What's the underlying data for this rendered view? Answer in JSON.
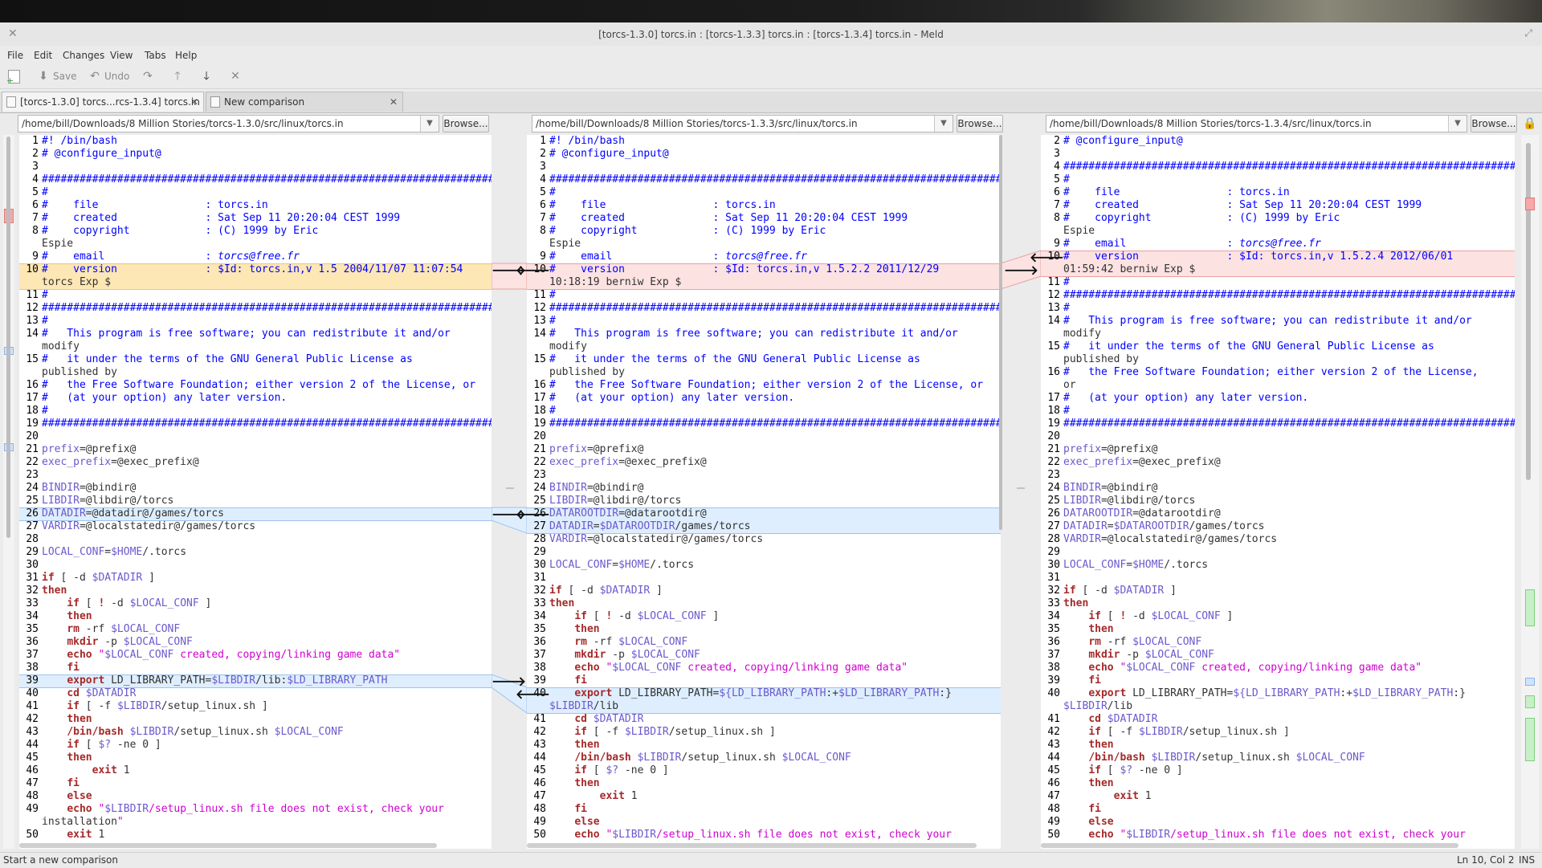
{
  "window": {
    "title": "[torcs-1.3.0] torcs.in : [torcs-1.3.3] torcs.in : [torcs-1.3.4] torcs.in - Meld"
  },
  "menu": [
    "File",
    "Edit",
    "Changes",
    "View",
    "Tabs",
    "Help"
  ],
  "toolbar": {
    "save_label": "Save",
    "undo_label": "Undo"
  },
  "tabs": [
    {
      "label": "[torcs-1.3.0] torcs...rcs-1.3.4] torcs.in",
      "active": true
    },
    {
      "label": "New comparison",
      "active": false
    }
  ],
  "paths": [
    "/home/bill/Downloads/8 Million Stories/torcs-1.3.0/src/linux/torcs.in",
    "/home/bill/Downloads/8 Million Stories/torcs-1.3.3/src/linux/torcs.in",
    "/home/bill/Downloads/8 Million Stories/torcs-1.3.4/src/linux/torcs.in"
  ],
  "browse_label": "Browse...",
  "left_lines": [
    {
      "n": "1",
      "t": "#! /bin/bash"
    },
    {
      "n": "2",
      "t": "# @configure_input@"
    },
    {
      "n": "3",
      "t": ""
    },
    {
      "n": "4",
      "t": "##########################################################################"
    },
    {
      "n": "5",
      "t": "#"
    },
    {
      "n": "6",
      "t": "#    file                 : torcs.in"
    },
    {
      "n": "7",
      "t": "#    created              : Sat Sep 11 20:20:04 CEST 1999"
    },
    {
      "n": "8",
      "t": "#    copyright            : (C) 1999 by Eric"
    },
    {
      "n": "",
      "t": "Espie"
    },
    {
      "n": "9",
      "t": "#    email                : torcs@free.fr"
    },
    {
      "n": "10",
      "t": "#    version              : $Id: torcs.in,v 1.5 2004/11/07 11:07:54"
    },
    {
      "n": "",
      "t": "torcs Exp $"
    },
    {
      "n": "11",
      "t": "#"
    },
    {
      "n": "12",
      "t": "##########################################################################"
    },
    {
      "n": "13",
      "t": "#"
    },
    {
      "n": "14",
      "t": "#   This program is free software; you can redistribute it and/or"
    },
    {
      "n": "",
      "t": "modify"
    },
    {
      "n": "15",
      "t": "#   it under the terms of the GNU General Public License as"
    },
    {
      "n": "",
      "t": "published by"
    },
    {
      "n": "16",
      "t": "#   the Free Software Foundation; either version 2 of the License, or"
    },
    {
      "n": "17",
      "t": "#   (at your option) any later version."
    },
    {
      "n": "18",
      "t": "#"
    },
    {
      "n": "19",
      "t": "##########################################################################"
    },
    {
      "n": "20",
      "t": ""
    },
    {
      "n": "21",
      "t": "prefix=@prefix@"
    },
    {
      "n": "22",
      "t": "exec_prefix=@exec_prefix@"
    },
    {
      "n": "23",
      "t": ""
    },
    {
      "n": "24",
      "t": "BINDIR=@bindir@"
    },
    {
      "n": "25",
      "t": "LIBDIR=@libdir@/torcs"
    },
    {
      "n": "26",
      "t": "DATADIR=@datadir@/games/torcs"
    },
    {
      "n": "27",
      "t": "VARDIR=@localstatedir@/games/torcs"
    },
    {
      "n": "28",
      "t": ""
    },
    {
      "n": "29",
      "t": "LOCAL_CONF=$HOME/.torcs"
    },
    {
      "n": "30",
      "t": ""
    },
    {
      "n": "31",
      "t": "if [ -d $DATADIR ]"
    },
    {
      "n": "32",
      "t": "then"
    },
    {
      "n": "33",
      "t": "    if [ ! -d $LOCAL_CONF ]"
    },
    {
      "n": "34",
      "t": "    then"
    },
    {
      "n": "35",
      "t": "    rm -rf $LOCAL_CONF"
    },
    {
      "n": "36",
      "t": "    mkdir -p $LOCAL_CONF"
    },
    {
      "n": "37",
      "t": "    echo \"$LOCAL_CONF created, copying/linking game data\""
    },
    {
      "n": "38",
      "t": "    fi"
    },
    {
      "n": "39",
      "t": "    export LD_LIBRARY_PATH=$LIBDIR/lib:$LD_LIBRARY_PATH"
    },
    {
      "n": "40",
      "t": "    cd $DATADIR"
    },
    {
      "n": "41",
      "t": "    if [ -f $LIBDIR/setup_linux.sh ]"
    },
    {
      "n": "42",
      "t": "    then"
    },
    {
      "n": "43",
      "t": "    /bin/bash $LIBDIR/setup_linux.sh $LOCAL_CONF"
    },
    {
      "n": "44",
      "t": "    if [ $? -ne 0 ]"
    },
    {
      "n": "45",
      "t": "    then"
    },
    {
      "n": "46",
      "t": "        exit 1"
    },
    {
      "n": "47",
      "t": "    fi"
    },
    {
      "n": "48",
      "t": "    else"
    },
    {
      "n": "49",
      "t": "    echo \"$LIBDIR/setup_linux.sh file does not exist, check your"
    },
    {
      "n": "",
      "t": "installation\""
    },
    {
      "n": "50",
      "t": "    exit 1"
    }
  ],
  "mid_lines": [
    {
      "n": "1",
      "t": "#! /bin/bash"
    },
    {
      "n": "2",
      "t": "# @configure_input@"
    },
    {
      "n": "3",
      "t": ""
    },
    {
      "n": "4",
      "t": "##########################################################################"
    },
    {
      "n": "5",
      "t": "#"
    },
    {
      "n": "6",
      "t": "#    file                 : torcs.in"
    },
    {
      "n": "7",
      "t": "#    created              : Sat Sep 11 20:20:04 CEST 1999"
    },
    {
      "n": "8",
      "t": "#    copyright            : (C) 1999 by Eric"
    },
    {
      "n": "",
      "t": "Espie"
    },
    {
      "n": "9",
      "t": "#    email                : torcs@free.fr"
    },
    {
      "n": "10",
      "t": "#    version              : $Id: torcs.in,v 1.5.2.2 2011/12/29"
    },
    {
      "n": "",
      "t": "10:18:19 berniw Exp $"
    },
    {
      "n": "11",
      "t": "#"
    },
    {
      "n": "12",
      "t": "##########################################################################"
    },
    {
      "n": "13",
      "t": "#"
    },
    {
      "n": "14",
      "t": "#   This program is free software; you can redistribute it and/or"
    },
    {
      "n": "",
      "t": "modify"
    },
    {
      "n": "15",
      "t": "#   it under the terms of the GNU General Public License as"
    },
    {
      "n": "",
      "t": "published by"
    },
    {
      "n": "16",
      "t": "#   the Free Software Foundation; either version 2 of the License, or"
    },
    {
      "n": "17",
      "t": "#   (at your option) any later version."
    },
    {
      "n": "18",
      "t": "#"
    },
    {
      "n": "19",
      "t": "##########################################################################"
    },
    {
      "n": "20",
      "t": ""
    },
    {
      "n": "21",
      "t": "prefix=@prefix@"
    },
    {
      "n": "22",
      "t": "exec_prefix=@exec_prefix@"
    },
    {
      "n": "23",
      "t": ""
    },
    {
      "n": "24",
      "t": "BINDIR=@bindir@"
    },
    {
      "n": "25",
      "t": "LIBDIR=@libdir@/torcs"
    },
    {
      "n": "26",
      "t": "DATAROOTDIR=@datarootdir@"
    },
    {
      "n": "27",
      "t": "DATADIR=$DATAROOTDIR/games/torcs"
    },
    {
      "n": "28",
      "t": "VARDIR=@localstatedir@/games/torcs"
    },
    {
      "n": "29",
      "t": ""
    },
    {
      "n": "30",
      "t": "LOCAL_CONF=$HOME/.torcs"
    },
    {
      "n": "31",
      "t": ""
    },
    {
      "n": "32",
      "t": "if [ -d $DATADIR ]"
    },
    {
      "n": "33",
      "t": "then"
    },
    {
      "n": "34",
      "t": "    if [ ! -d $LOCAL_CONF ]"
    },
    {
      "n": "35",
      "t": "    then"
    },
    {
      "n": "36",
      "t": "    rm -rf $LOCAL_CONF"
    },
    {
      "n": "37",
      "t": "    mkdir -p $LOCAL_CONF"
    },
    {
      "n": "38",
      "t": "    echo \"$LOCAL_CONF created, copying/linking game data\""
    },
    {
      "n": "39",
      "t": "    fi"
    },
    {
      "n": "40",
      "t": "    export LD_LIBRARY_PATH=${LD_LIBRARY_PATH:+$LD_LIBRARY_PATH:}"
    },
    {
      "n": "",
      "t": "$LIBDIR/lib"
    },
    {
      "n": "41",
      "t": "    cd $DATADIR"
    },
    {
      "n": "42",
      "t": "    if [ -f $LIBDIR/setup_linux.sh ]"
    },
    {
      "n": "43",
      "t": "    then"
    },
    {
      "n": "44",
      "t": "    /bin/bash $LIBDIR/setup_linux.sh $LOCAL_CONF"
    },
    {
      "n": "45",
      "t": "    if [ $? -ne 0 ]"
    },
    {
      "n": "46",
      "t": "    then"
    },
    {
      "n": "47",
      "t": "        exit 1"
    },
    {
      "n": "48",
      "t": "    fi"
    },
    {
      "n": "49",
      "t": "    else"
    },
    {
      "n": "50",
      "t": "    echo \"$LIBDIR/setup_linux.sh file does not exist, check your"
    }
  ],
  "right_lines": [
    {
      "n": "2",
      "t": "# @configure_input@"
    },
    {
      "n": "3",
      "t": ""
    },
    {
      "n": "4",
      "t": "##########################################################################"
    },
    {
      "n": "5",
      "t": "#"
    },
    {
      "n": "6",
      "t": "#    file                 : torcs.in"
    },
    {
      "n": "7",
      "t": "#    created              : Sat Sep 11 20:20:04 CEST 1999"
    },
    {
      "n": "8",
      "t": "#    copyright            : (C) 1999 by Eric"
    },
    {
      "n": "",
      "t": "Espie"
    },
    {
      "n": "9",
      "t": "#    email                : torcs@free.fr"
    },
    {
      "n": "10",
      "t": "#    version              : $Id: torcs.in,v 1.5.2.4 2012/06/01"
    },
    {
      "n": "",
      "t": "01:59:42 berniw Exp $"
    },
    {
      "n": "11",
      "t": "#"
    },
    {
      "n": "12",
      "t": "##########################################################################"
    },
    {
      "n": "13",
      "t": "#"
    },
    {
      "n": "14",
      "t": "#   This program is free software; you can redistribute it and/or"
    },
    {
      "n": "",
      "t": "modify"
    },
    {
      "n": "15",
      "t": "#   it under the terms of the GNU General Public License as"
    },
    {
      "n": "",
      "t": "published by"
    },
    {
      "n": "16",
      "t": "#   the Free Software Foundation; either version 2 of the License,"
    },
    {
      "n": "",
      "t": "or"
    },
    {
      "n": "17",
      "t": "#   (at your option) any later version."
    },
    {
      "n": "18",
      "t": "#"
    },
    {
      "n": "19",
      "t": "##########################################################################"
    },
    {
      "n": "20",
      "t": ""
    },
    {
      "n": "21",
      "t": "prefix=@prefix@"
    },
    {
      "n": "22",
      "t": "exec_prefix=@exec_prefix@"
    },
    {
      "n": "23",
      "t": ""
    },
    {
      "n": "24",
      "t": "BINDIR=@bindir@"
    },
    {
      "n": "25",
      "t": "LIBDIR=@libdir@/torcs"
    },
    {
      "n": "26",
      "t": "DATAROOTDIR=@datarootdir@"
    },
    {
      "n": "27",
      "t": "DATADIR=$DATAROOTDIR/games/torcs"
    },
    {
      "n": "28",
      "t": "VARDIR=@localstatedir@/games/torcs"
    },
    {
      "n": "29",
      "t": ""
    },
    {
      "n": "30",
      "t": "LOCAL_CONF=$HOME/.torcs"
    },
    {
      "n": "31",
      "t": ""
    },
    {
      "n": "32",
      "t": "if [ -d $DATADIR ]"
    },
    {
      "n": "33",
      "t": "then"
    },
    {
      "n": "34",
      "t": "    if [ ! -d $LOCAL_CONF ]"
    },
    {
      "n": "35",
      "t": "    then"
    },
    {
      "n": "36",
      "t": "    rm -rf $LOCAL_CONF"
    },
    {
      "n": "37",
      "t": "    mkdir -p $LOCAL_CONF"
    },
    {
      "n": "38",
      "t": "    echo \"$LOCAL_CONF created, copying/linking game data\""
    },
    {
      "n": "39",
      "t": "    fi"
    },
    {
      "n": "40",
      "t": "    export LD_LIBRARY_PATH=${LD_LIBRARY_PATH:+$LD_LIBRARY_PATH:}"
    },
    {
      "n": "",
      "t": "$LIBDIR/lib"
    },
    {
      "n": "41",
      "t": "    cd $DATADIR"
    },
    {
      "n": "42",
      "t": "    if [ -f $LIBDIR/setup_linux.sh ]"
    },
    {
      "n": "43",
      "t": "    then"
    },
    {
      "n": "44",
      "t": "    /bin/bash $LIBDIR/setup_linux.sh $LOCAL_CONF"
    },
    {
      "n": "45",
      "t": "    if [ $? -ne 0 ]"
    },
    {
      "n": "46",
      "t": "    then"
    },
    {
      "n": "47",
      "t": "        exit 1"
    },
    {
      "n": "48",
      "t": "    fi"
    },
    {
      "n": "49",
      "t": "    else"
    },
    {
      "n": "50",
      "t": "    echo \"$LIBDIR/setup_linux.sh file does not exist, check your"
    }
  ],
  "status": {
    "message": "Start a new comparison",
    "position": "Ln 10, Col 2",
    "mode": "INS"
  },
  "colors": {
    "conflict": "#fde7b4",
    "change": "#fde2e2",
    "modified": "#dfeefe",
    "comment": "#0000ff",
    "keyword": "#a52a2a",
    "variable": "#6a5acd",
    "string": "#d000d0"
  }
}
